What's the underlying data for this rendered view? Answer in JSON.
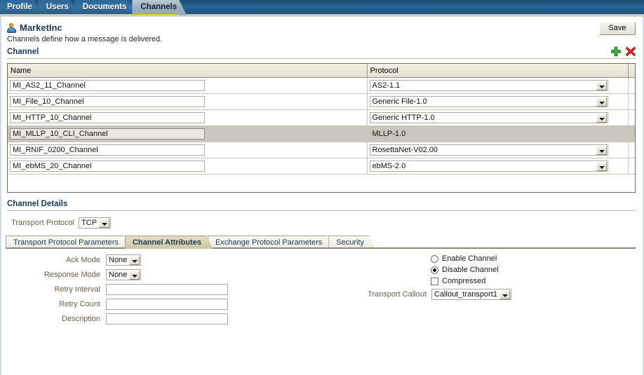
{
  "top_tabs": [
    {
      "label": "Profile",
      "active": false
    },
    {
      "label": "Users",
      "active": false
    },
    {
      "label": "Documents",
      "active": false
    },
    {
      "label": "Channels",
      "active": true
    }
  ],
  "header": {
    "title": "MarketInc",
    "subtitle": "Channels define how a message is delivered.",
    "save_label": "Save",
    "person_icon": "person-icon"
  },
  "channel_section": {
    "title": "Channel",
    "add_icon": "plus-icon",
    "delete_icon": "delete-x-icon"
  },
  "table": {
    "columns": [
      "Name",
      "Protocol"
    ],
    "rows": [
      {
        "name": "MI_AS2_11_Channel",
        "protocol": "AS2-1.1",
        "selected": false
      },
      {
        "name": "MI_File_10_Channel",
        "protocol": "Generic File-1.0",
        "selected": false
      },
      {
        "name": "MI_HTTP_10_Channel",
        "protocol": "Generic HTTP-1.0",
        "selected": false
      },
      {
        "name": "MI_MLLP_10_CLI_Channel",
        "protocol": "MLLP-1.0",
        "selected": true
      },
      {
        "name": "MI_RNIF_0200_Channel",
        "protocol": "RosettaNet-V02.00",
        "selected": false
      },
      {
        "name": "MI_ebMS_20_Channel",
        "protocol": "ebMS-2.0",
        "selected": false
      }
    ]
  },
  "details": {
    "title": "Channel Details",
    "transport_protocol_label": "Transport Protocol",
    "transport_protocol_value": "TCP"
  },
  "inner_tabs": [
    {
      "label": "Transport Protocol Parameters",
      "active": false
    },
    {
      "label": "Channel Attributes",
      "active": true
    },
    {
      "label": "Exchange Protocol Parameters",
      "active": false
    },
    {
      "label": "Security",
      "active": false
    }
  ],
  "attributes": {
    "ack_mode_label": "Ack Mode",
    "ack_mode_value": "None",
    "response_mode_label": "Response Mode",
    "response_mode_value": "None",
    "retry_interval_label": "Retry Interval",
    "retry_interval_value": "",
    "retry_count_label": "Retry Count",
    "retry_count_value": "",
    "description_label": "Description",
    "description_value": "",
    "enable_channel_label": "Enable Channel",
    "disable_channel_label": "Disable Channel",
    "compressed_label": "Compressed",
    "channel_state": "disabled",
    "compressed_checked": false,
    "transport_callout_label": "Transport Callout",
    "transport_callout_value": "Callout_transport1"
  },
  "colors": {
    "tab_bar": "#265d8a",
    "active_tab": "#9fb2c4",
    "tab_underline": "#e8c33a",
    "heading": "#1b3a57",
    "label": "#6d5e48",
    "selected_row": "#c9c7bd",
    "add_icon": "#2faa2f",
    "delete_icon": "#d32020",
    "active_inner_tab": "#cfc5a2"
  }
}
